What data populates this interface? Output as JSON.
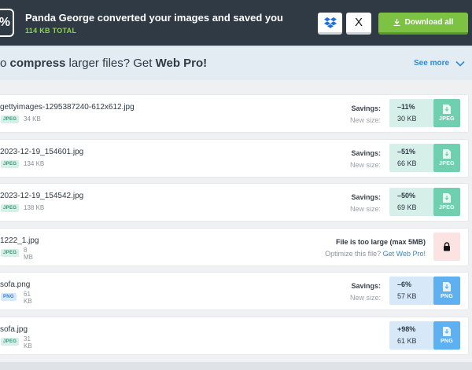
{
  "header": {
    "percent_badge": "%",
    "title": "Panda George converted your images and saved you",
    "subtitle": "114 KB TOTAL",
    "dropbox_icon": "dropbox-icon",
    "x_label": "X",
    "download_all": "Download all",
    "download_icon": "download-icon"
  },
  "promo": {
    "text_pre": "o ",
    "text_bold1": "compress",
    "text_mid": " larger files? Get ",
    "text_bold2": "Web Pro!",
    "see_more": "See more"
  },
  "files": [
    {
      "name": "gettyimages-1295387240-612x612.jpg",
      "type": "JPEG",
      "size": "34 KB",
      "savings_label": "Savings:",
      "newsize_label": "New size:",
      "savings": "–11%",
      "new_size": "30 KB",
      "download_label": "JPEG"
    },
    {
      "name": "2023-12-19_154601.jpg",
      "type": "JPEG",
      "size": "134 KB",
      "savings_label": "Savings:",
      "newsize_label": "New size:",
      "savings": "–51%",
      "new_size": "66 KB",
      "download_label": "JPEG"
    },
    {
      "name": "2023-12-19_154542.jpg",
      "type": "JPEG",
      "size": "138 KB",
      "savings_label": "Savings:",
      "newsize_label": "New size:",
      "savings": "–50%",
      "new_size": "69 KB",
      "download_label": "JPEG"
    },
    {
      "name": "1222_1.jpg",
      "type": "JPEG",
      "size": "8 MB",
      "too_large": "File is too large (max 5MB)",
      "optimize_pre": "Optimize this file?",
      "optimize_link": "Get Web Pro!"
    },
    {
      "name": "sofa.png",
      "type": "PNG",
      "size": "61 KB",
      "savings_label": "Savings:",
      "newsize_label": "New size:",
      "savings": "–6%",
      "new_size": "57 KB",
      "download_label": "PNG"
    },
    {
      "name": "sofa.jpg",
      "type": "JPEG",
      "size": "31 KB",
      "savings": "+98%",
      "new_size": "61 KB",
      "download_label": "PNG"
    }
  ]
}
